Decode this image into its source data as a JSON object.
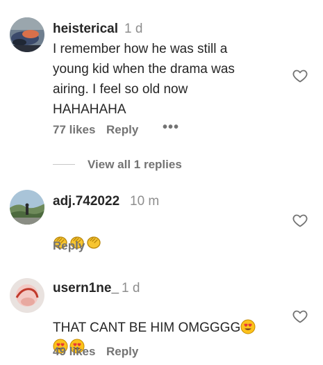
{
  "comments": [
    {
      "username": "heisterical",
      "time": "1 d",
      "text": "I remember how he was still a\nyoung kid when the drama was\nairing. I feel so old now\nHAHAHAHA",
      "likes": "77 likes",
      "reply_label": "Reply",
      "more_label": "•••",
      "view_replies": "View all 1 replies"
    },
    {
      "username": "adj.742022",
      "time": "10 m",
      "emoji": [
        "clapping-hands",
        "clapping-hands",
        "clapping-hands"
      ],
      "reply_label": "Reply"
    },
    {
      "username": "usern1ne_",
      "time": "1 d",
      "text": "THAT CANT BE HIM OMGGGG",
      "emoji": [
        "heart-eyes",
        "heart-eyes",
        "heart-eyes"
      ],
      "likes": "49 likes",
      "reply_label": "Reply"
    }
  ],
  "colors": {
    "text": "#262626",
    "secondary": "#737373",
    "time": "#8e8e8e",
    "divider": "#c7c7c7"
  },
  "icons": {
    "like": "heart-outline-icon",
    "more": "more-dots-icon"
  }
}
